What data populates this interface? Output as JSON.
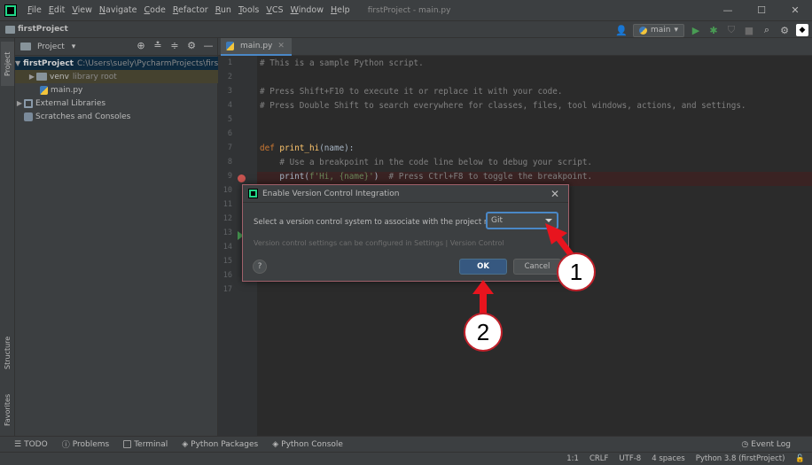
{
  "app": {
    "menu": [
      "File",
      "Edit",
      "View",
      "Navigate",
      "Code",
      "Refactor",
      "Run",
      "Tools",
      "VCS",
      "Window",
      "Help"
    ],
    "window_title": "firstProject - main.py",
    "window_controls": [
      "—",
      "☐",
      "✕"
    ]
  },
  "navbar": {
    "breadcrumb": "firstProject",
    "branch": "main"
  },
  "left_strip": {
    "project_tab": "Project",
    "structure_tab": "Structure",
    "favorites_tab": "Favorites"
  },
  "project_panel": {
    "title": "Project",
    "tree": [
      {
        "label": "firstProject",
        "hint": "C:\\Users\\suely\\PycharmProjects\\firstPr",
        "icon": "folder-icon"
      },
      {
        "label": "venv",
        "hint": "library root",
        "icon": "folder-icon"
      },
      {
        "label": "main.py",
        "icon": "python-file-icon"
      },
      {
        "label": "External Libraries",
        "icon": "library-icon"
      },
      {
        "label": "Scratches and Consoles",
        "icon": "scratches-icon"
      }
    ]
  },
  "editor": {
    "tab_label": "main.py",
    "line_numbers": [
      "1",
      "2",
      "3",
      "4",
      "5",
      "6",
      "7",
      "8",
      "9",
      "10",
      "11",
      "12",
      "13",
      "14",
      "15",
      "16",
      "17"
    ],
    "lines": {
      "l1": "# This is a sample Python script.",
      "l3": "# Press Shift+F10 to execute it or replace it with your code.",
      "l4": "# Press Double Shift to search everywhere for classes, files, tool windows, actions, and settings.",
      "l7_kw": "def",
      "l7_fn": "print_hi",
      "l7_rest": "(name):",
      "l8": "    # Use a breakpoint in the code line below to debug your script.",
      "l9_code": "    print(",
      "l9_str": "f'Hi, {name}'",
      "l9_close": ")",
      "l9_comment": "  # Press Ctrl+F8 to toggle the breakpoint."
    }
  },
  "dialog": {
    "title": "Enable Version Control Integration",
    "label": "Select a version control system to associate with the project root:",
    "selected_vcs": "Git",
    "hint": "Version control settings can be configured in Settings | Version Control",
    "help": "?",
    "ok": "OK",
    "cancel": "Cancel"
  },
  "annotations": {
    "badge1": "1",
    "badge2": "2"
  },
  "toolwindows": [
    "TODO",
    "Problems",
    "Terminal",
    "Python Packages",
    "Python Console"
  ],
  "event_log": "Event Log",
  "status": [
    "1:1",
    "CRLF",
    "UTF-8",
    "4 spaces",
    "Python 3.8 (firstProject)"
  ],
  "colors": {
    "accent": "#4a88c7",
    "annotation_red": "#e8141e",
    "breakpoint": "#c75450"
  }
}
